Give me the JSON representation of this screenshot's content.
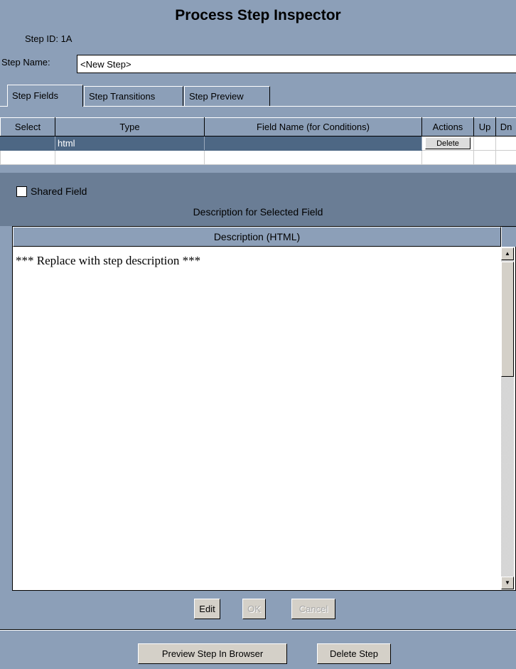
{
  "window": {
    "title": "Process Step Inspector"
  },
  "step": {
    "id_label": "Step ID: 1A",
    "name_label": "Step Name:",
    "name_value": "<New Step>"
  },
  "tabs": [
    {
      "label": "Step Fields",
      "active": true
    },
    {
      "label": "Step Transitions",
      "active": false
    },
    {
      "label": "Step Preview",
      "active": false
    }
  ],
  "fields_table": {
    "columns": [
      "Select",
      "Type",
      "Field Name (for Conditions)",
      "Actions",
      "Up",
      "Dn"
    ],
    "rows": [
      {
        "select": "",
        "type": "html",
        "field_name": "",
        "action_label": "Delete",
        "up": "",
        "dn": ""
      }
    ]
  },
  "shared_field": {
    "label": "Shared Field",
    "checked": false
  },
  "description": {
    "section_title": "Description for Selected Field",
    "column_header": "Description (HTML)",
    "content": "*** Replace with step description ***"
  },
  "editor_buttons": {
    "edit": "Edit",
    "ok": "OK",
    "cancel": "Cancel"
  },
  "footer_buttons": {
    "preview": "Preview Step In Browser",
    "delete": "Delete Step"
  },
  "colors": {
    "background": "#8c9fb8",
    "selected_row": "#4d6784",
    "panel": "#6a7d95"
  },
  "icons": {
    "scroll_up": "scroll-up-arrow-icon",
    "scroll_down": "scroll-down-arrow-icon"
  }
}
